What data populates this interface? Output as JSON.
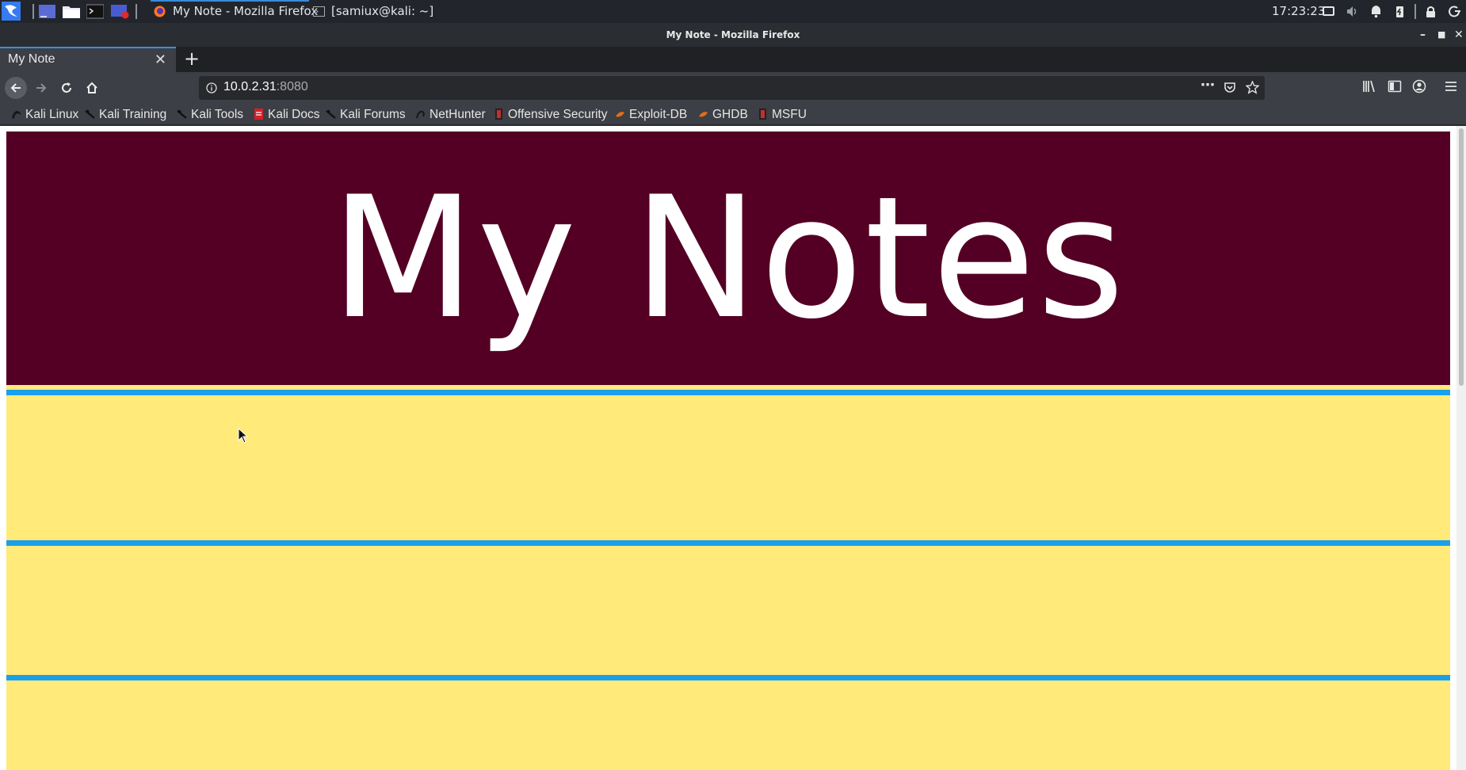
{
  "taskbar": {
    "apps": [
      {
        "label": "My Note - Mozilla Firefox",
        "icon": "firefox-icon"
      },
      {
        "label": "[samiux@kali: ~]",
        "icon": "terminal-icon"
      }
    ],
    "clock": "17:23:23"
  },
  "window": {
    "title": "My Note - Mozilla Firefox"
  },
  "tabs": [
    {
      "title": "My Note"
    }
  ],
  "urlbar": {
    "host": "10.0.2.31",
    "port": ":8080"
  },
  "bookmarks": [
    {
      "label": "Kali Linux",
      "icon": "kali-dragon-icon"
    },
    {
      "label": "Kali Training",
      "icon": "kali-dragon-icon"
    },
    {
      "label": "Kali Tools",
      "icon": "kali-dragon-icon"
    },
    {
      "label": "Kali Docs",
      "icon": "kali-docs-icon"
    },
    {
      "label": "Kali Forums",
      "icon": "kali-dragon-icon"
    },
    {
      "label": "NetHunter",
      "icon": "nethunter-icon"
    },
    {
      "label": "Offensive Security",
      "icon": "offsec-icon"
    },
    {
      "label": "Exploit-DB",
      "icon": "exploitdb-icon"
    },
    {
      "label": "GHDB",
      "icon": "ghdb-icon"
    },
    {
      "label": "MSFU",
      "icon": "offsec-icon"
    }
  ],
  "page": {
    "banner_title": "My Notes",
    "colors": {
      "banner": "#540024",
      "paper": "#ffea7a",
      "rule": "#1aa0ea"
    }
  }
}
